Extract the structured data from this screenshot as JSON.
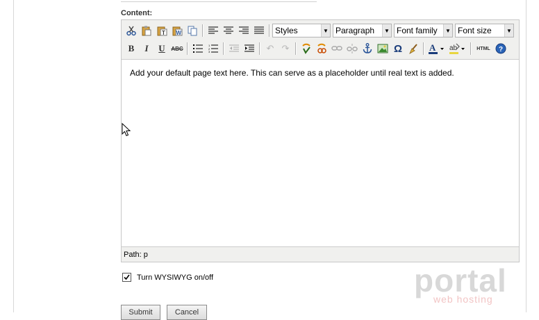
{
  "form": {
    "content_label": "Content:",
    "body_text": "Add your default page text here. This can serve as a placeholder until real text is added.",
    "path_label": "Path: p",
    "wysiwyg_label": "Turn WYSIWYG on/off",
    "wysiwyg_checked": true,
    "submit_label": "Submit",
    "cancel_label": "Cancel"
  },
  "toolbar": {
    "styles": "Styles",
    "format": "Paragraph",
    "font_family": "Font family",
    "font_size": "Font size",
    "bold": "B",
    "italic": "I",
    "underline": "U",
    "strike": "ABC",
    "html": "HTML",
    "omega": "Ω",
    "help": "?"
  },
  "watermark": {
    "brand": "portal",
    "sub": "web hosting"
  }
}
